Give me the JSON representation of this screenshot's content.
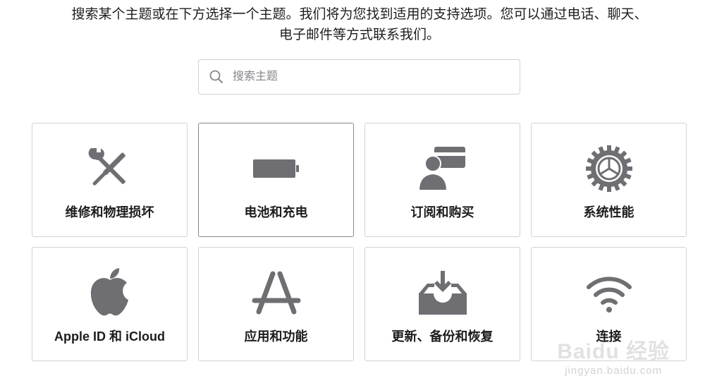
{
  "intro_text": "搜索某个主题或在下方选择一个主题。我们将为您找到适用的支持选项。您可以通过电话、聊天、电子邮件等方式联系我们。",
  "search": {
    "placeholder": "搜索主题",
    "icon": "search-icon"
  },
  "topics": [
    {
      "label": "维修和物理损坏",
      "icon": "wrench-screwdriver-icon"
    },
    {
      "label": "电池和充电",
      "icon": "battery-icon",
      "selected": true
    },
    {
      "label": "订阅和购买",
      "icon": "person-card-icon"
    },
    {
      "label": "系统性能",
      "icon": "gear-icon"
    },
    {
      "label": "Apple ID 和 iCloud",
      "icon": "apple-logo-icon"
    },
    {
      "label": "应用和功能",
      "icon": "app-store-icon"
    },
    {
      "label": "更新、备份和恢复",
      "icon": "download-tray-icon"
    },
    {
      "label": "连接",
      "icon": "wifi-icon"
    }
  ],
  "watermark": {
    "main": "Baidu 经验",
    "sub": "jingyan.baidu.com"
  },
  "colors": {
    "icon_gray": "#6e6e73",
    "border": "#d2d2d7",
    "text": "#1d1d1f"
  }
}
